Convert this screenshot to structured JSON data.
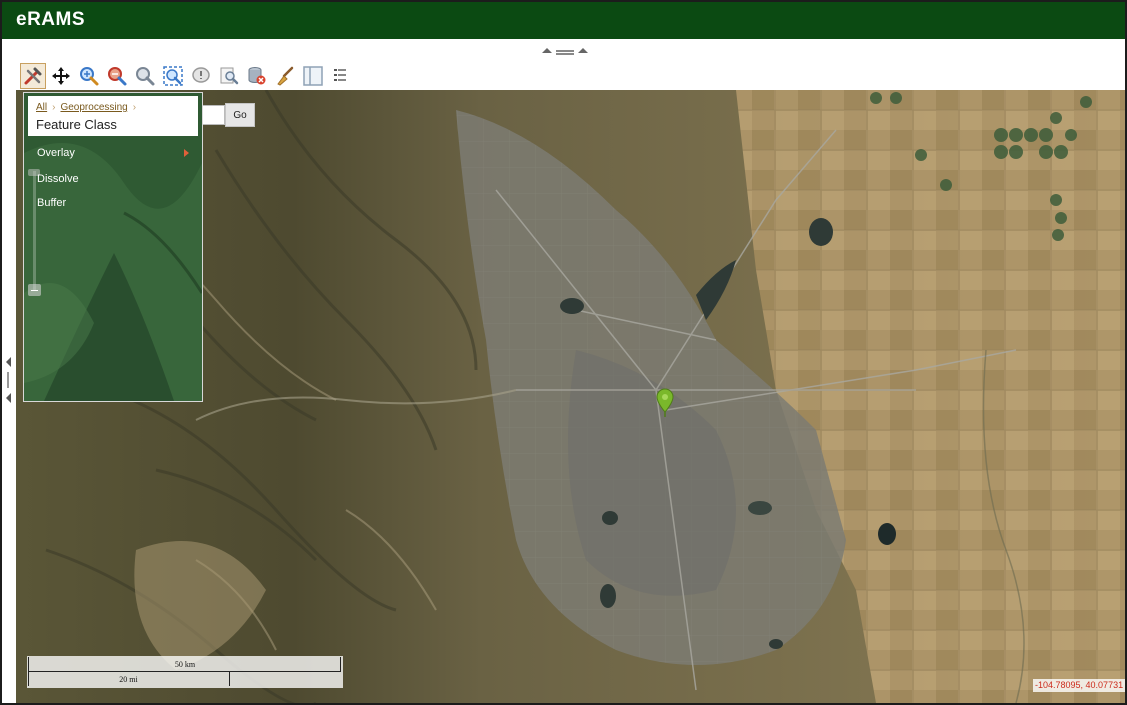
{
  "app": {
    "title": "eRAMS"
  },
  "toolbar": {
    "tools": [
      {
        "icon": "tools-icon",
        "active": true
      },
      {
        "icon": "pan-icon"
      },
      {
        "icon": "zoom-in-icon"
      },
      {
        "icon": "zoom-out-icon"
      },
      {
        "icon": "zoom-previous-icon"
      },
      {
        "icon": "zoom-extent-icon"
      },
      {
        "icon": "identify-icon"
      },
      {
        "icon": "search-layer-icon"
      },
      {
        "icon": "clear-database-icon"
      },
      {
        "icon": "clear-graphics-icon"
      },
      {
        "icon": "panel-icon"
      },
      {
        "icon": "legend-icon"
      }
    ]
  },
  "search": {
    "go_label": "Go"
  },
  "panel": {
    "breadcrumb": [
      "All",
      "Geoprocessing"
    ],
    "title": "Feature Class",
    "items": [
      {
        "label": "Overlay",
        "has_submenu": true
      },
      {
        "label": "Dissolve"
      },
      {
        "label": "Buffer"
      }
    ]
  },
  "map": {
    "scale_km_label": "50 km",
    "scale_mi_label": "20 mi",
    "coordinates": "-104.78095, 40.07731"
  },
  "colors": {
    "header": "#0b4a12",
    "accent_link": "#7a5a1e",
    "coords_text": "#cc2b1b",
    "marker": "#7ab82b"
  }
}
